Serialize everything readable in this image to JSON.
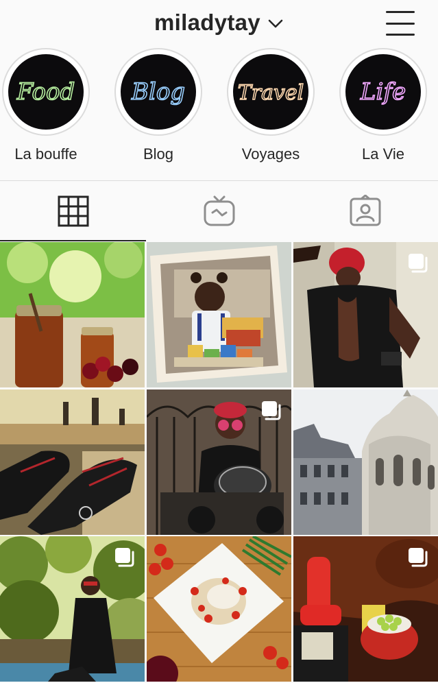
{
  "header": {
    "username": "miladytay",
    "dropdown_icon": "chevron-down-icon",
    "menu_icon": "hamburger-menu-icon"
  },
  "highlights": [
    {
      "label": "La bouffe",
      "cover_text": "Food",
      "neon_color": "#b7f0a0"
    },
    {
      "label": "Blog",
      "cover_text": "Blog",
      "neon_color": "#9ad0ff"
    },
    {
      "label": "Voyages",
      "cover_text": "Travel",
      "neon_color": "#ffd9b0"
    },
    {
      "label": "La Vie",
      "cover_text": "Life",
      "neon_color": "#f2a8ff"
    }
  ],
  "tabs": [
    {
      "name": "grid",
      "icon": "grid-icon",
      "active": true
    },
    {
      "name": "igtv",
      "icon": "igtv-icon",
      "active": false
    },
    {
      "name": "tagged",
      "icon": "tagged-icon",
      "active": false
    }
  ],
  "posts": [
    {
      "subject": "jars of jam with cherries by a window",
      "multi": false
    },
    {
      "subject": "vintage childhood photo with toy blocks",
      "multi": false
    },
    {
      "subject": "woman in red beanie with open-back top",
      "multi": true
    },
    {
      "subject": "sneakers with red laces on a ledge",
      "multi": false
    },
    {
      "subject": "woman with red sunglasses on motorcycle",
      "multi": true
    },
    {
      "subject": "basilica domes against the sky",
      "multi": false
    },
    {
      "subject": "woman in black sitting among greenery",
      "multi": true
    },
    {
      "subject": "pasta plate with tomatoes and green beans",
      "multi": false
    },
    {
      "subject": "red socks on leather couch with grapes bowl",
      "multi": true
    }
  ]
}
